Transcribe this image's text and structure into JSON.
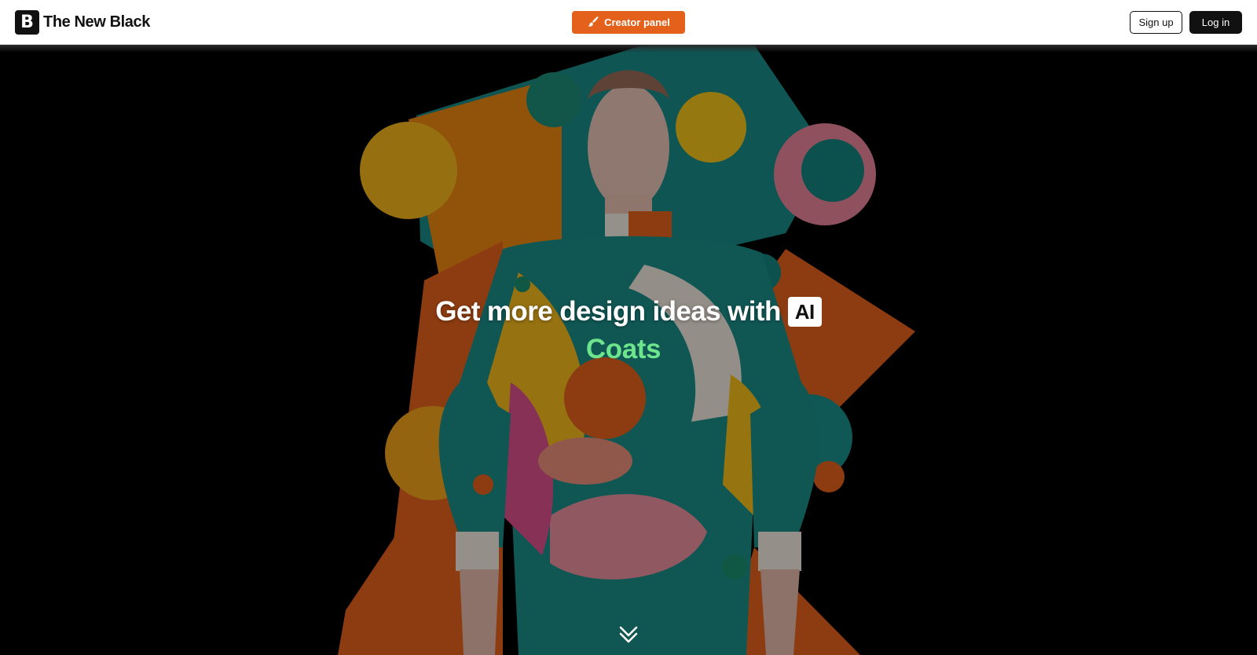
{
  "header": {
    "logo_letter": "B",
    "brand_name": "The New Black",
    "creator_panel_label": "Creator panel",
    "creator_panel_icon": "brush-icon",
    "sign_up_label": "Sign up",
    "log_in_label": "Log in"
  },
  "hero": {
    "headline": "Get more design ideas with",
    "ai_badge": "AI",
    "category": "Coats",
    "scroll_icon": "double-chevron-down-icon"
  },
  "colors": {
    "accent_orange": "#e4611c",
    "category_green": "#6ee58c",
    "hero_background": "#000000"
  }
}
